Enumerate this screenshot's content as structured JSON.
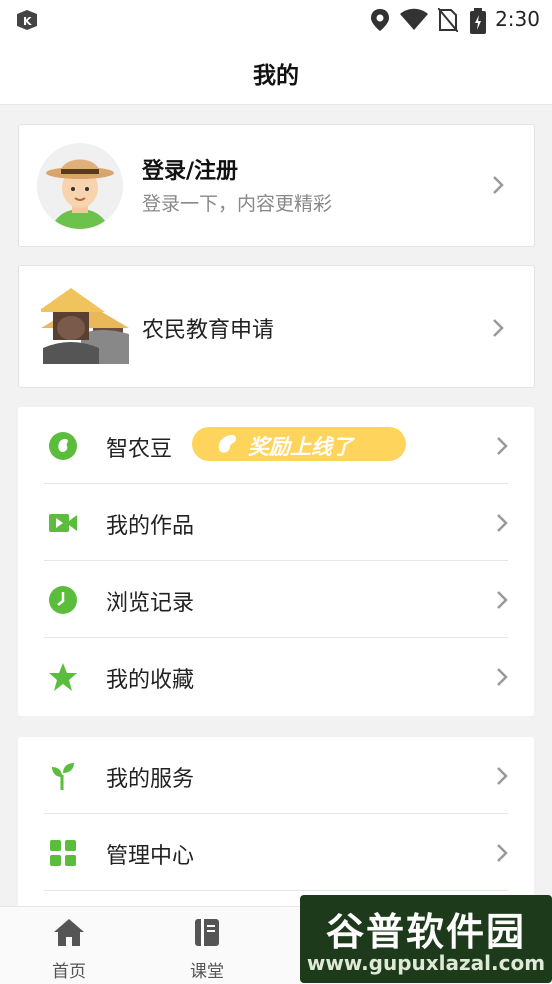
{
  "status_bar": {
    "time": "2:30"
  },
  "header": {
    "title": "我的"
  },
  "login_card": {
    "title": "登录/注册",
    "subtitle": "登录一下，内容更精彩"
  },
  "edu_card": {
    "label": "农民教育申请"
  },
  "menu1": {
    "items": [
      {
        "label": "智农豆",
        "icon": "bean-icon",
        "badge": "奖励上线了"
      },
      {
        "label": "我的作品",
        "icon": "video-icon"
      },
      {
        "label": "浏览记录",
        "icon": "clock-icon"
      },
      {
        "label": "我的收藏",
        "icon": "star-icon"
      }
    ]
  },
  "menu2": {
    "items": [
      {
        "label": "我的服务",
        "icon": "sprout-icon"
      },
      {
        "label": "管理中心",
        "icon": "grid-icon"
      }
    ]
  },
  "tabbar": {
    "tabs": [
      {
        "label": "首页",
        "icon": "home-icon"
      },
      {
        "label": "课堂",
        "icon": "book-icon"
      }
    ]
  },
  "watermark": {
    "line1": "谷普软件园",
    "line2": "www.gupuxlazal.com"
  },
  "colors": {
    "accent": "#5bbd3c",
    "badge": "#ffd45c",
    "watermark_bg": "#1d3a1a"
  }
}
